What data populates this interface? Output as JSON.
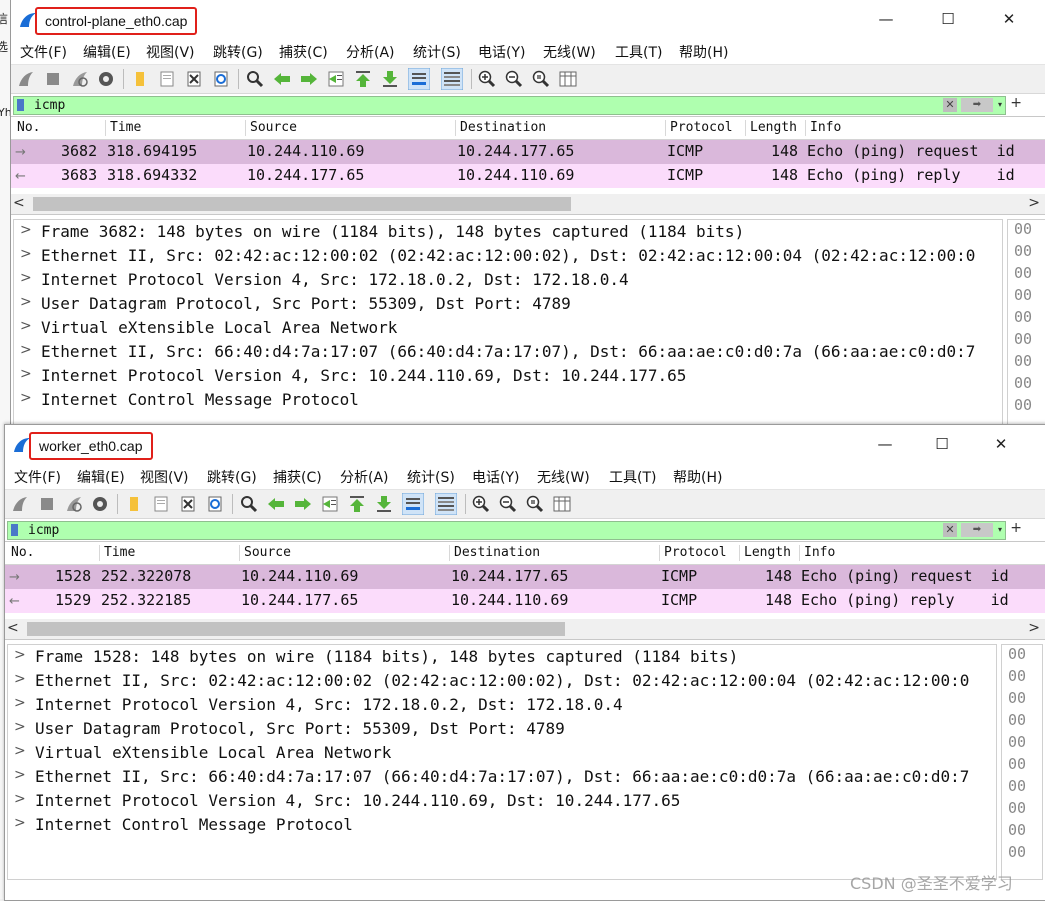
{
  "window1": {
    "title": "control-plane_eth0.cap",
    "controls": {
      "minimize": "—",
      "maximize": "☐",
      "close": "✕"
    },
    "menu": [
      "文件(F)",
      "编辑(E)",
      "视图(V)",
      "跳转(G)",
      "捕获(C)",
      "分析(A)",
      "统计(S)",
      "电话(Y)",
      "无线(W)",
      "工具(T)",
      "帮助(H)"
    ],
    "filter": {
      "value": "icmp",
      "plus": "+"
    },
    "columns": [
      "No.",
      "Time",
      "Source",
      "Destination",
      "Protocol",
      "Length",
      "Info"
    ],
    "packets": [
      {
        "arrow": "→",
        "no": "3682",
        "time": "318.694195",
        "source": "10.244.110.69",
        "destination": "10.244.177.65",
        "protocol": "ICMP",
        "length": "148",
        "info": "Echo (ping) request  id"
      },
      {
        "arrow": "←",
        "no": "3683",
        "time": "318.694332",
        "source": "10.244.177.65",
        "destination": "10.244.110.69",
        "protocol": "ICMP",
        "length": "148",
        "info": "Echo (ping) reply    id"
      }
    ],
    "details": [
      "Frame 3682: 148 bytes on wire (1184 bits), 148 bytes captured (1184 bits)",
      "Ethernet II, Src: 02:42:ac:12:00:02 (02:42:ac:12:00:02), Dst: 02:42:ac:12:00:04 (02:42:ac:12:00:0",
      "Internet Protocol Version 4, Src: 172.18.0.2, Dst: 172.18.0.4",
      "User Datagram Protocol, Src Port: 55309, Dst Port: 4789",
      "Virtual eXtensible Local Area Network",
      "Ethernet II, Src: 66:40:d4:7a:17:07 (66:40:d4:7a:17:07), Dst: 66:aa:ae:c0:d0:7a (66:aa:ae:c0:d0:7",
      "Internet Protocol Version 4, Src: 10.244.110.69, Dst: 10.244.177.65",
      "Internet Control Message Protocol"
    ],
    "hex": [
      "00",
      "00",
      "00",
      "00",
      "00",
      "00",
      "00",
      "00",
      "00"
    ]
  },
  "window2": {
    "title": "worker_eth0.cap",
    "controls": {
      "minimize": "—",
      "maximize": "☐",
      "close": "✕"
    },
    "menu": [
      "文件(F)",
      "编辑(E)",
      "视图(V)",
      "跳转(G)",
      "捕获(C)",
      "分析(A)",
      "统计(S)",
      "电话(Y)",
      "无线(W)",
      "工具(T)",
      "帮助(H)"
    ],
    "filter": {
      "value": "icmp",
      "plus": "+"
    },
    "columns": [
      "No.",
      "Time",
      "Source",
      "Destination",
      "Protocol",
      "Length",
      "Info"
    ],
    "packets": [
      {
        "arrow": "→",
        "no": "1528",
        "time": "252.322078",
        "source": "10.244.110.69",
        "destination": "10.244.177.65",
        "protocol": "ICMP",
        "length": "148",
        "info": "Echo (ping) request  id"
      },
      {
        "arrow": "←",
        "no": "1529",
        "time": "252.322185",
        "source": "10.244.177.65",
        "destination": "10.244.110.69",
        "protocol": "ICMP",
        "length": "148",
        "info": "Echo (ping) reply    id"
      }
    ],
    "details": [
      "Frame 1528: 148 bytes on wire (1184 bits), 148 bytes captured (1184 bits)",
      "Ethernet II, Src: 02:42:ac:12:00:02 (02:42:ac:12:00:02), Dst: 02:42:ac:12:00:04 (02:42:ac:12:00:0",
      "Internet Protocol Version 4, Src: 172.18.0.2, Dst: 172.18.0.4",
      "User Datagram Protocol, Src Port: 55309, Dst Port: 4789",
      "Virtual eXtensible Local Area Network",
      "Ethernet II, Src: 66:40:d4:7a:17:07 (66:40:d4:7a:17:07), Dst: 66:aa:ae:c0:d0:7a (66:aa:ae:c0:d0:7",
      "Internet Protocol Version 4, Src: 10.244.110.69, Dst: 10.244.177.65",
      "Internet Control Message Protocol"
    ],
    "hex": [
      "00",
      "00",
      "00",
      "00",
      "00",
      "00",
      "00",
      "00",
      "00",
      "00"
    ]
  },
  "background_edge": [
    "信",
    "选",
    "Yh"
  ],
  "watermark": "CSDN @圣圣不爱学习",
  "colors": {
    "filter_valid": "#afffaf",
    "row_request": "#dab8db",
    "row_reply": "#fbdcfb",
    "title_highlight": "#e0201a"
  },
  "toolbar_icons": [
    "shark-start-icon",
    "stop-icon",
    "restart-icon",
    "options-gear-icon",
    "open-folder-icon",
    "save-file-icon",
    "close-file-icon",
    "reload-icon",
    "find-icon",
    "go-back-icon",
    "go-forward-icon",
    "go-to-packet-icon",
    "first-packet-icon",
    "last-packet-icon",
    "autoscroll-icon",
    "colorize-icon",
    "zoom-in-icon",
    "zoom-out-icon",
    "zoom-normal-icon",
    "resize-columns-icon"
  ]
}
